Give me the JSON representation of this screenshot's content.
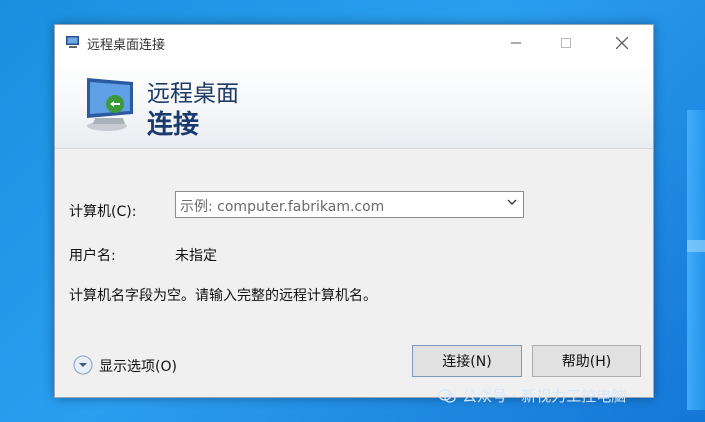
{
  "window": {
    "title": "远程桌面连接"
  },
  "banner": {
    "line1": "远程桌面",
    "line2": "连接"
  },
  "form": {
    "computer_label": "计算机(C):",
    "computer_placeholder": "示例: computer.fabrikam.com",
    "user_label": "用户名:",
    "user_value": "未指定",
    "message": "计算机名字段为空。请输入完整的远程计算机名。"
  },
  "footer": {
    "options_label": "显示选项(O)",
    "connect_label": "连接(N)",
    "help_label": "帮助(H)"
  },
  "watermark": "公众号 · 新视力工控电脑"
}
